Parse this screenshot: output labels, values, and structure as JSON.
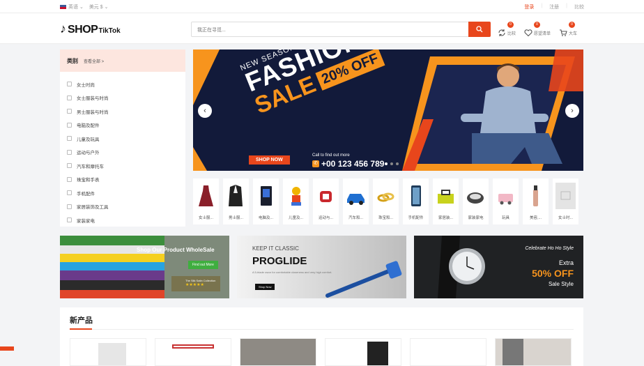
{
  "topbar": {
    "language": "英语",
    "currency": "美元 $",
    "login": "登录",
    "register": "注册",
    "compare": "比较"
  },
  "header": {
    "logo_main": "SHOP",
    "logo_sub": "TikTok",
    "search_placeholder": "我正在寻觅...",
    "compare_label": "比较",
    "compare_count": "0",
    "wishlist_label": "愿望清单",
    "wishlist_count": "0",
    "cart_label": "大车",
    "cart_count": "0"
  },
  "categories": {
    "title": "类别",
    "view_all": "查看全部 >",
    "items": [
      {
        "label": "女士时尚",
        "icon": "dress-icon"
      },
      {
        "label": "女士服装与时尚",
        "icon": "hanger-icon"
      },
      {
        "label": "男士服装与时尚",
        "icon": "shirt-icon"
      },
      {
        "label": "电脑及配件",
        "icon": "monitor-icon"
      },
      {
        "label": "儿童及玩具",
        "icon": "toy-icon"
      },
      {
        "label": "运动与户外",
        "icon": "ball-icon"
      },
      {
        "label": "汽车和摩托车",
        "icon": "car-icon"
      },
      {
        "label": "珠宝和手表",
        "icon": "ring-icon"
      },
      {
        "label": "手机配件",
        "icon": "phone-icon"
      },
      {
        "label": "家居装饰及工具",
        "icon": "tools-icon"
      },
      {
        "label": "家装家电",
        "icon": "appliance-icon"
      }
    ]
  },
  "banner": {
    "kicker": "NEW SEASON",
    "title": "FASHION",
    "subtitle": "SALE",
    "discount": "20% OFF",
    "cta": "SHOP NOW",
    "call_text": "Call to find out more",
    "phone": "+00 123 456 789"
  },
  "strip": [
    "女士服...",
    "男士服...",
    "电脑及...",
    "儿童及...",
    "运动与...",
    "汽车和...",
    "珠宝和...",
    "手机配件",
    "家居装...",
    "家装家电",
    "玩具",
    "美容,...",
    "女士时..."
  ],
  "promos": {
    "p1_title": "Shop Our Product WholeSale",
    "p1_cta": "Find out More",
    "p1_sub": "The Silk Satin Collection",
    "p2_kicker": "KEEP IT CLASSIC",
    "p2_title": "PROGLIDE",
    "p2_desc": "A 5-blade razor for comfortable closeness and very high comfort.",
    "p2_cta": "Shop Now",
    "p3_kicker": "Celebrate Ho Ho Style",
    "p3_extra": "Extra",
    "p3_off": "50% OFF",
    "p3_style": "Sale Style"
  },
  "new_products": {
    "title": "新产品"
  },
  "colors": {
    "accent": "#e8461c",
    "banner_bg": "#121a3a",
    "banner_orange": "#f7941d"
  }
}
